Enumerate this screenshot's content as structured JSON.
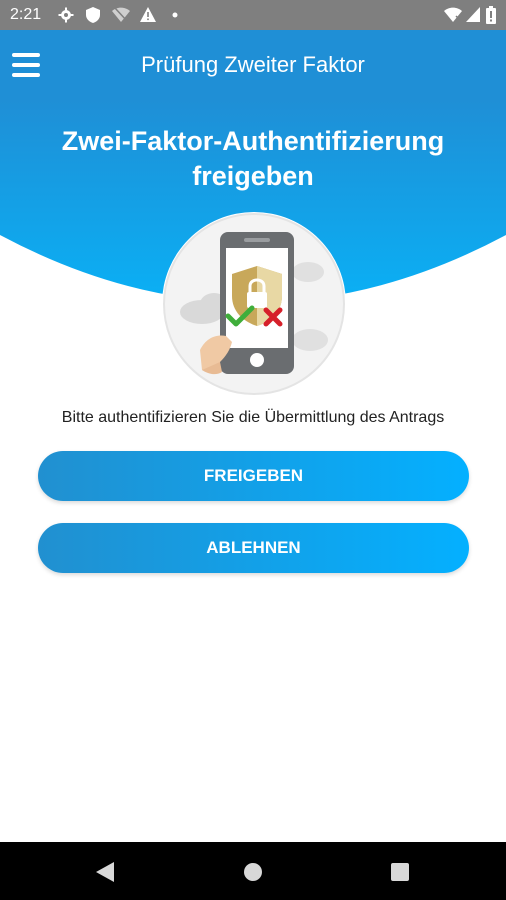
{
  "status_bar": {
    "time": "2:21",
    "icons": [
      "gear-icon",
      "shield-icon",
      "wifi-off-icon",
      "warning-icon",
      "dot-icon",
      "wifi-icon",
      "signal-icon",
      "battery-icon"
    ]
  },
  "app_bar": {
    "title": "Prüfung Zweiter Faktor",
    "menu_icon": "hamburger-menu-icon"
  },
  "hero": {
    "title": "Zwei-Faktor-Authentifizierung freigeben"
  },
  "illustration": {
    "icon": "phone-shield-lock-icon",
    "colors": {
      "accept": "#3fae3b",
      "reject": "#d6202a",
      "shield": "#c8a85a"
    }
  },
  "instruction": "Bitte authentifizieren Sie die Übermittlung des Antrags",
  "buttons": {
    "approve": "FREIGEBEN",
    "reject": "ABLEHNEN"
  },
  "nav_bar": {
    "icons": [
      "back-icon",
      "home-icon",
      "recents-icon"
    ]
  },
  "colors": {
    "primary": "#1f8fd6",
    "button_start": "#2190d0",
    "button_end": "#04b0ff",
    "status_bar": "#7f7f7f"
  }
}
